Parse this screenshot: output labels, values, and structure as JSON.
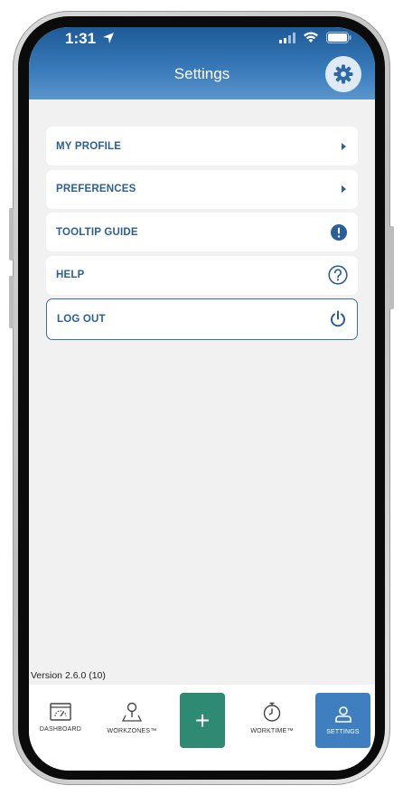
{
  "status_bar": {
    "time": "1:31"
  },
  "header": {
    "title": "Settings"
  },
  "menu": {
    "items": [
      {
        "label": "MY PROFILE",
        "icon": "chevron-right-icon"
      },
      {
        "label": "PREFERENCES",
        "icon": "chevron-right-icon"
      },
      {
        "label": "TOOLTIP GUIDE",
        "icon": "exclamation-circle-icon"
      },
      {
        "label": "HELP",
        "icon": "question-circle-icon"
      },
      {
        "label": "LOG OUT",
        "icon": "power-icon"
      }
    ]
  },
  "version": "Version 2.6.0 (10)",
  "tabbar": {
    "dashboard": "DASHBOARD",
    "workzones": "WORKZONES™",
    "add": "+",
    "worktime": "WORKTIME™",
    "settings": "SETTINGS"
  },
  "colors": {
    "header": "#1e5a96",
    "menu_text": "#2b5f95",
    "add_button": "#2e8a72",
    "active_tab": "#3f7fbf"
  }
}
